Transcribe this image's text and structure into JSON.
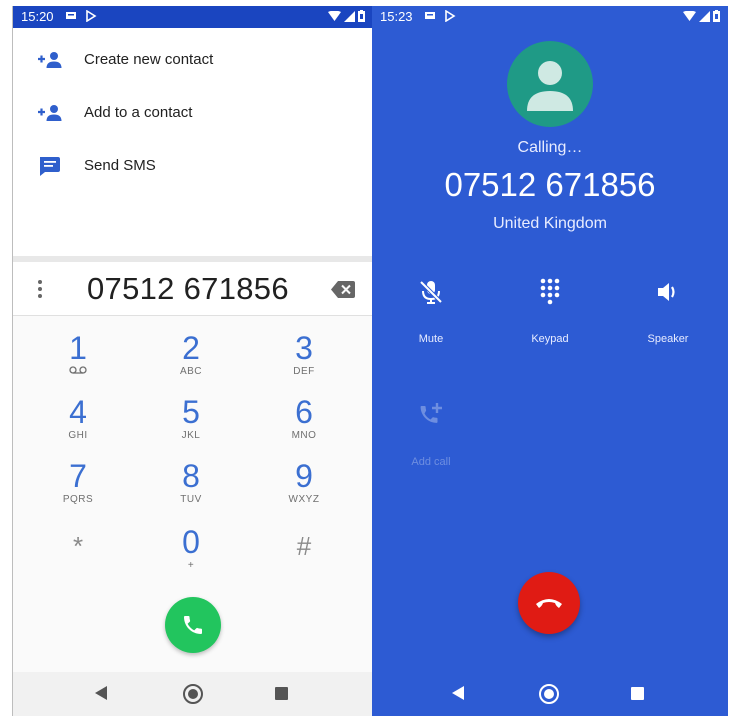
{
  "left_screen": {
    "status_bar": {
      "time": "15:20"
    },
    "menu": {
      "items": [
        {
          "label": "Create new contact",
          "icon": "add-person-icon"
        },
        {
          "label": "Add to a contact",
          "icon": "add-person-icon"
        },
        {
          "label": "Send SMS",
          "icon": "message-icon"
        }
      ]
    },
    "dialer": {
      "digits": "07512 671856",
      "keys": [
        {
          "num": "1",
          "sub": ""
        },
        {
          "num": "2",
          "sub": "ABC"
        },
        {
          "num": "3",
          "sub": "DEF"
        },
        {
          "num": "4",
          "sub": "GHI"
        },
        {
          "num": "5",
          "sub": "JKL"
        },
        {
          "num": "6",
          "sub": "MNO"
        },
        {
          "num": "7",
          "sub": "PQRS"
        },
        {
          "num": "8",
          "sub": "TUV"
        },
        {
          "num": "9",
          "sub": "WXYZ"
        },
        {
          "num": "*",
          "sub": ""
        },
        {
          "num": "0",
          "sub": "+"
        },
        {
          "num": "#",
          "sub": ""
        }
      ]
    }
  },
  "right_screen": {
    "status_bar": {
      "time": "15:23"
    },
    "calling_text": "Calling…",
    "number": "07512 671856",
    "country": "United Kingdom",
    "actions": [
      {
        "label": "Mute",
        "icon": "mic-off-icon"
      },
      {
        "label": "Keypad",
        "icon": "dialpad-icon"
      },
      {
        "label": "Speaker",
        "icon": "speaker-icon"
      },
      {
        "label": "Add call",
        "icon": "add-call-icon"
      }
    ]
  },
  "colors": {
    "status_bar_left": "#1a45c0",
    "call_screen_bg": "#2d5bd3",
    "digit_blue": "#3b6fd1",
    "call_button_green": "#22c55e",
    "end_call_red": "#e01b14",
    "avatar_teal": "#1f9a86"
  }
}
